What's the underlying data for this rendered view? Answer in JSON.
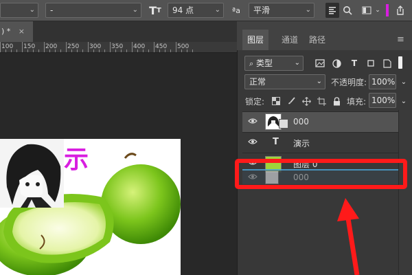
{
  "options_bar": {
    "font_family_value": "",
    "font_style_value": "-",
    "font_size_value": "94 点",
    "aa_label": "ªa",
    "aa_method_value": "平滑"
  },
  "document_tab": {
    "title": ") *",
    "close": "×"
  },
  "ruler": {
    "labels": [
      "100",
      "150",
      "200",
      "250",
      "300",
      "350",
      "400",
      "450",
      "500"
    ]
  },
  "canvas": {
    "text_layer_content": "示"
  },
  "layers_panel": {
    "tabs": [
      {
        "label": "图层"
      },
      {
        "label": "通道"
      },
      {
        "label": "路径"
      }
    ],
    "menu_icon": "≡",
    "filter_kind": "类型",
    "blend_mode": "正常",
    "opacity_label": "不透明度:",
    "opacity_value": "100%",
    "lock_label": "锁定:",
    "fill_label": "填充:",
    "fill_value": "100%",
    "layers": [
      {
        "name": "000",
        "type": "smart-object",
        "selected": true
      },
      {
        "name": "演示",
        "type": "text",
        "selected": false
      },
      {
        "name": "图层 0",
        "type": "image",
        "selected": false
      },
      {
        "name": "000",
        "type": "smart-object-dragging",
        "selected": false
      }
    ]
  },
  "colors": {
    "highlight_red": "#ff1a1a",
    "magenta_text": "#d81ee0",
    "panel_bg": "#383838"
  }
}
